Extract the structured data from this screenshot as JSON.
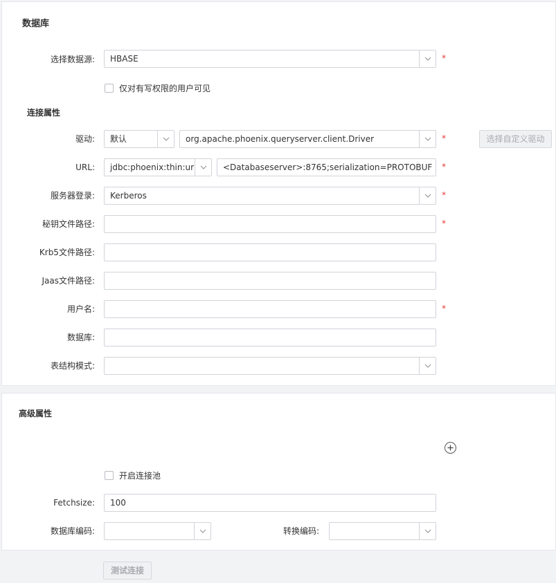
{
  "database_section": {
    "title": "数据库",
    "datasource": {
      "label": "选择数据源:",
      "value": "HBASE"
    },
    "write_permission_checkbox": {
      "label": "仅对有写权限的用户可见",
      "checked": false
    }
  },
  "connection_section": {
    "title": "连接属性",
    "driver": {
      "label": "驱动:",
      "type_value": "默认",
      "class_value": "org.apache.phoenix.queryserver.client.Driver",
      "custom_button": "选择自定义驱动"
    },
    "url": {
      "label": "URL:",
      "prefix_value": "jdbc:phoenix:thin:url=ht",
      "value": "<Databaseserver>:8765;serialization=PROTOBUF"
    },
    "server_login": {
      "label": "服务器登录:",
      "value": "Kerberos"
    },
    "keytab_path": {
      "label": "秘钥文件路径:",
      "value": ""
    },
    "krb5_path": {
      "label": "Krb5文件路径:",
      "value": ""
    },
    "jaas_path": {
      "label": "Jaas文件路径:",
      "value": ""
    },
    "username": {
      "label": "用户名:",
      "value": ""
    },
    "database": {
      "label": "数据库:",
      "value": ""
    },
    "schema": {
      "label": "表结构模式:",
      "value": ""
    },
    "required_mark": "*"
  },
  "advanced_section": {
    "title": "高级属性",
    "add_icon": "plus-circle-icon",
    "pool_checkbox": {
      "label": "开启连接池",
      "checked": false
    },
    "fetchsize": {
      "label": "Fetchsize:",
      "value": "100"
    },
    "db_encoding": {
      "label": "数据库编码:",
      "value": ""
    },
    "convert_encoding": {
      "label": "转换编码:",
      "value": ""
    }
  },
  "test_button": "测试连接"
}
